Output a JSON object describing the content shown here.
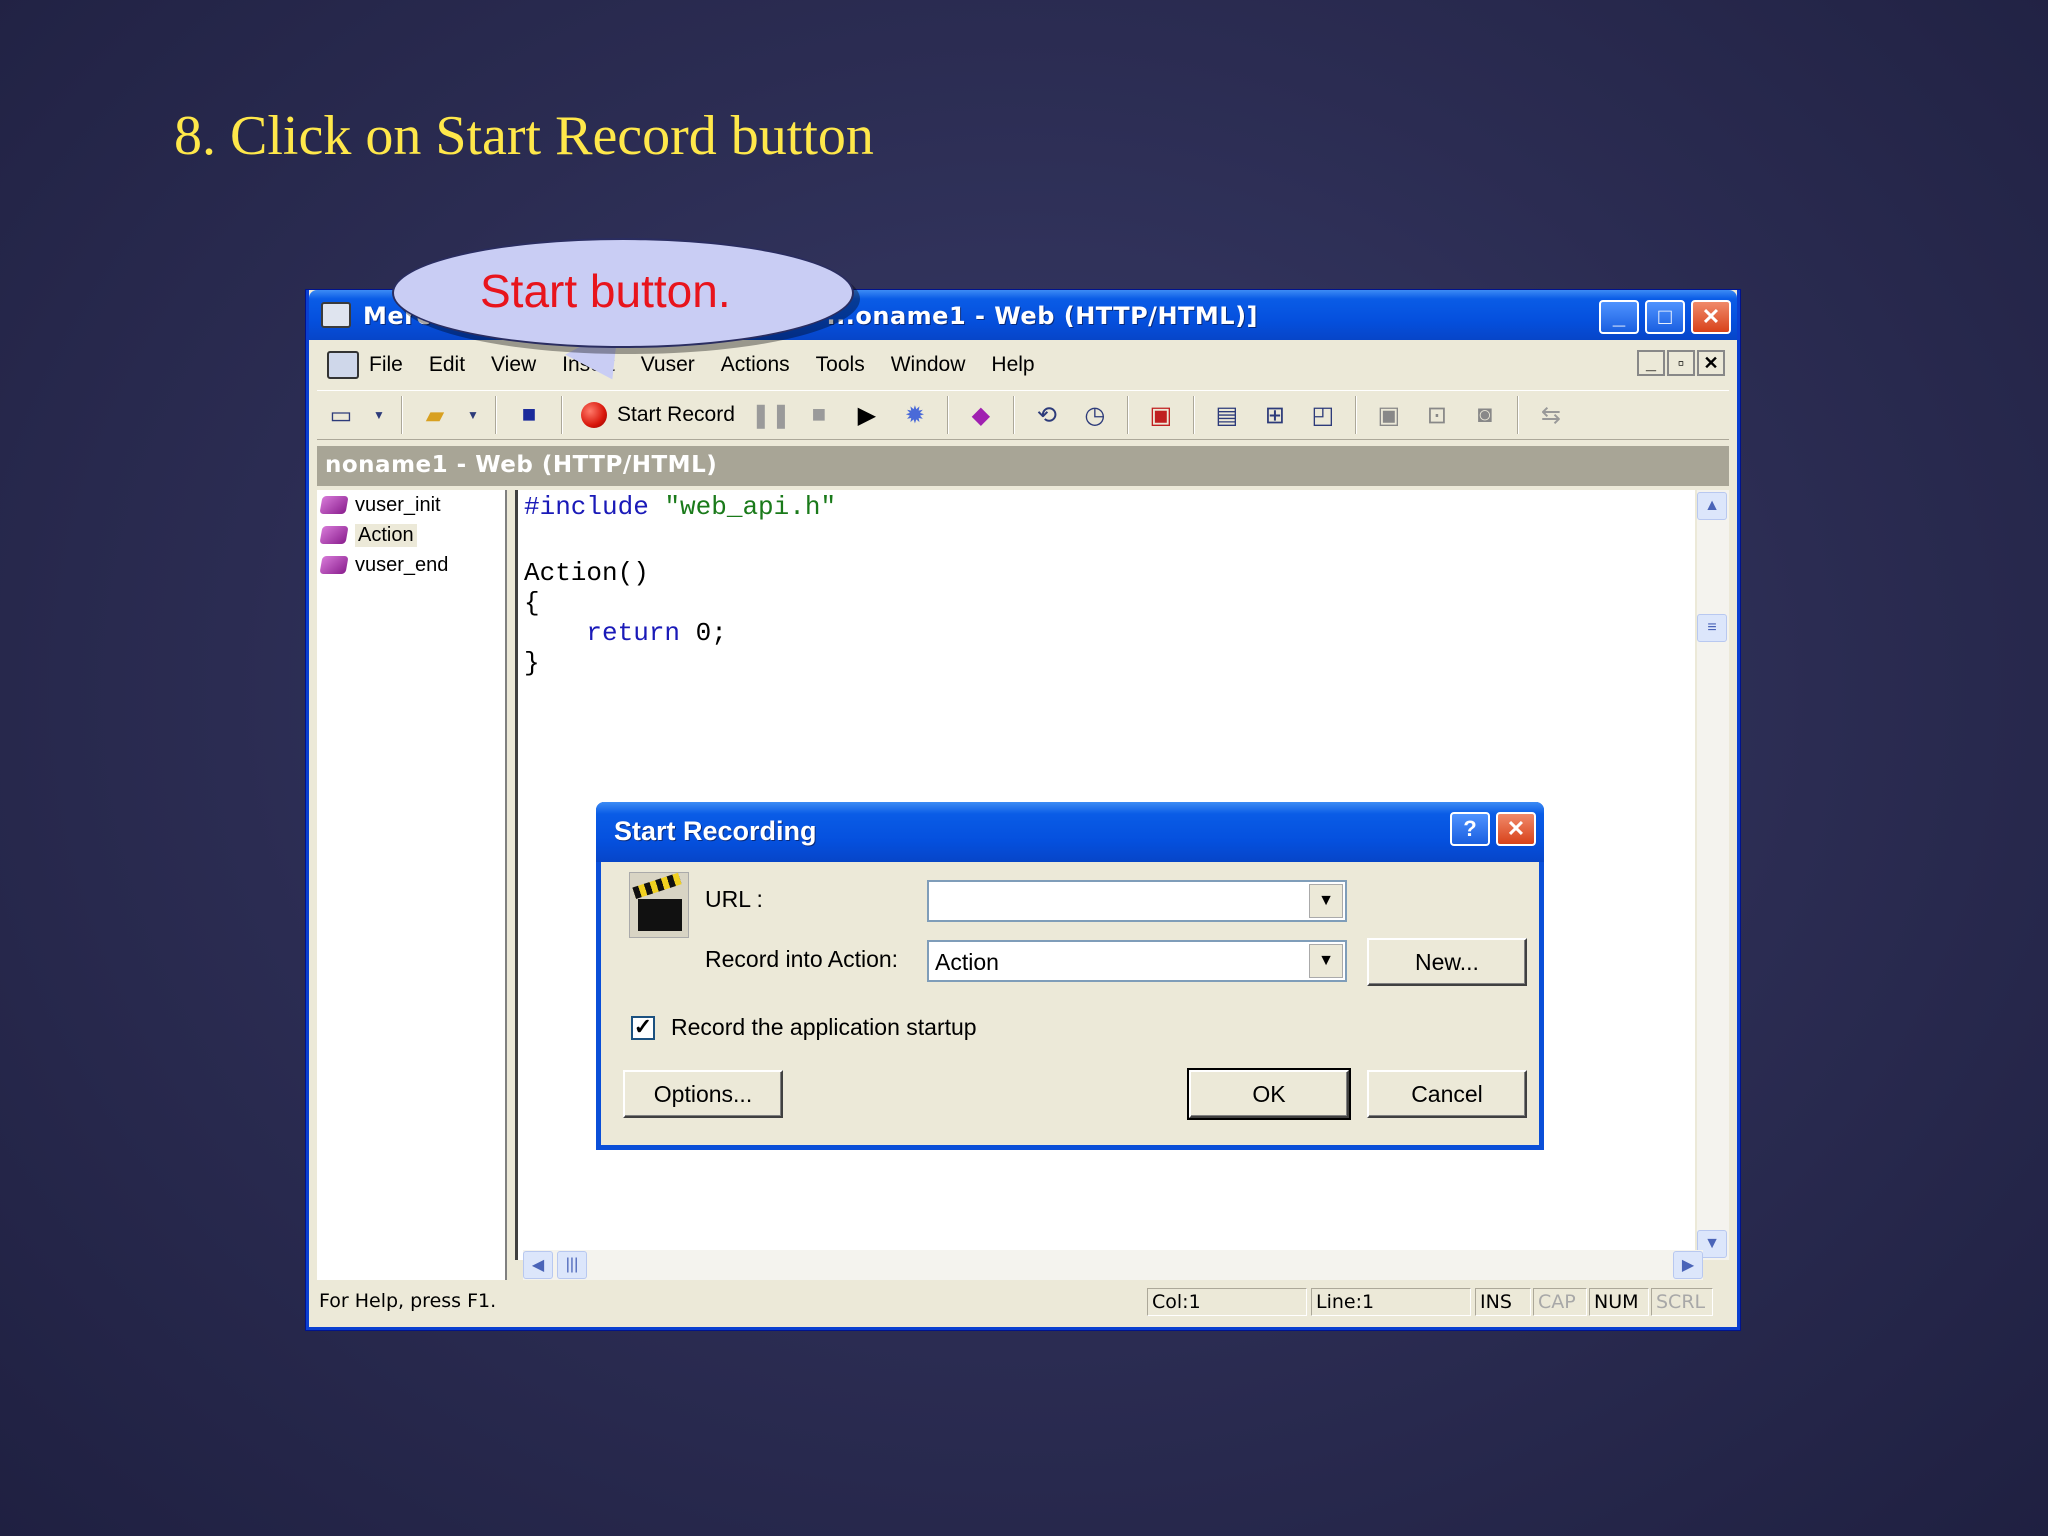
{
  "slide": {
    "title": "8. Click on Start Record button"
  },
  "callout": {
    "text": "Start button."
  },
  "window": {
    "title": "Mercu...   ...noname1 - Web (HTTP/HTML)]",
    "title_left": "Mercu",
    "title_right": "...oname1 - Web (HTTP/HTML)]",
    "controls": {
      "minimize": "_",
      "maximize": "□",
      "close": "✕"
    }
  },
  "menu": {
    "items": [
      "File",
      "Edit",
      "View",
      "Insert",
      "Vuser",
      "Actions",
      "Tools",
      "Window",
      "Help"
    ]
  },
  "toolbar": {
    "start_record_label": "Start Record",
    "tools": [
      "new-script-icon",
      "open-folder-icon",
      "save-icon",
      "record-icon",
      "pause-icon",
      "stop-icon",
      "play-icon",
      "gear-icon",
      "action-block-icon",
      "rendezvous-icon",
      "transaction-icon",
      "view-tree-icon",
      "view-script-icon",
      "view-thumbnail-icon",
      "step-icon",
      "split-icon",
      "record-options-icon",
      "refresh-icon"
    ]
  },
  "document": {
    "title": "noname1 - Web (HTTP/HTML)"
  },
  "tree": {
    "items": [
      {
        "label": "vuser_init"
      },
      {
        "label": "Action"
      },
      {
        "label": "vuser_end"
      }
    ]
  },
  "code": {
    "line1_kw": "#include",
    "line1_str": "\"web_api.h\"",
    "line2": "Action()",
    "line3": "{",
    "line4_kw": "return",
    "line4_rest": " 0;",
    "line5": "}"
  },
  "status": {
    "help": "For Help, press F1.",
    "col": "Col:1",
    "line": "Line:1",
    "ins": "INS",
    "cap": "CAP",
    "num": "NUM",
    "scrl": "SCRL"
  },
  "dialog": {
    "title": "Start Recording",
    "help_btn": "?",
    "close_btn": "✕",
    "url_label": "URL :",
    "url_value": "",
    "record_into_label": "Record into Action:",
    "record_into_value": "Action",
    "new_button": "New...",
    "checkbox_label": "Record the application startup",
    "checkbox_checked": true,
    "options_button": "Options...",
    "ok_button": "OK",
    "cancel_button": "Cancel"
  }
}
